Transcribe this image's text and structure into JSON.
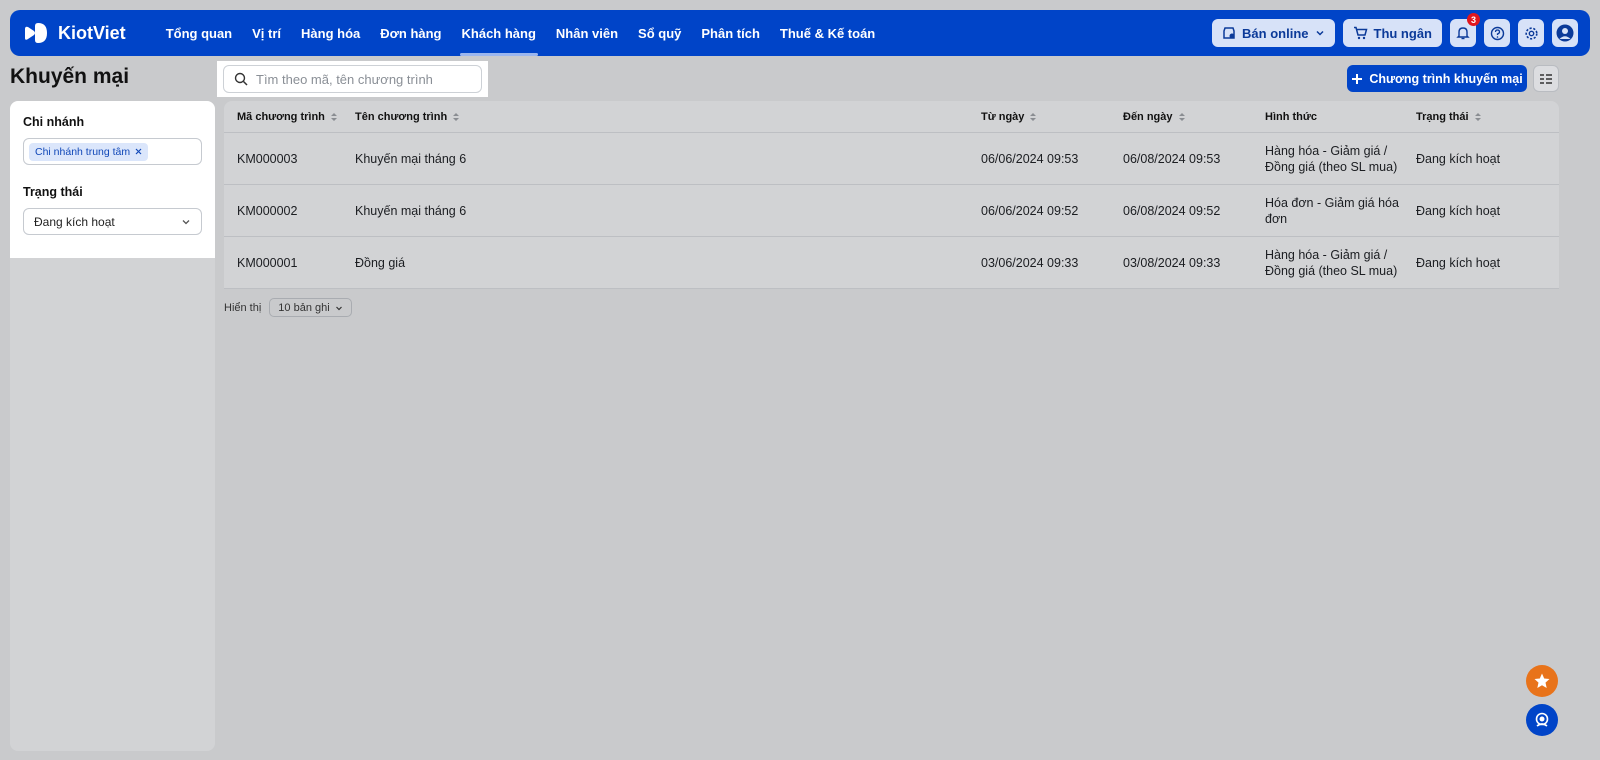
{
  "brand": {
    "name": "KiotViet"
  },
  "nav": {
    "items": [
      {
        "label": "Tổng quan"
      },
      {
        "label": "Vị trí"
      },
      {
        "label": "Hàng hóa"
      },
      {
        "label": "Đơn hàng"
      },
      {
        "label": "Khách hàng",
        "active": true
      },
      {
        "label": "Nhân viên"
      },
      {
        "label": "Sổ quỹ"
      },
      {
        "label": "Phân tích"
      },
      {
        "label": "Thuế & Kế toán"
      }
    ],
    "online_label": "Bán online",
    "cashier_label": "Thu ngân",
    "notification_count": "3"
  },
  "page": {
    "title": "Khuyến mại",
    "search_placeholder": "Tìm theo mã, tên chương trình",
    "add_button_label": "Chương trình khuyến mại"
  },
  "filters": {
    "branch_label": "Chi nhánh",
    "branch_tag": "Chi nhánh trung tâm",
    "status_label": "Trạng thái",
    "status_value": "Đang kích hoạt"
  },
  "table": {
    "columns": [
      "Mã chương trình",
      "Tên chương trình",
      "Từ ngày",
      "Đến ngày",
      "Hình thức",
      "Trạng thái"
    ],
    "rows": [
      {
        "code": "KM000003",
        "name": "Khuyến mại tháng 6",
        "from": "06/06/2024 09:53",
        "to": "06/08/2024 09:53",
        "type": "Hàng hóa - Giảm giá / Đồng giá (theo SL mua)",
        "status": "Đang kích hoạt"
      },
      {
        "code": "KM000002",
        "name": "Khuyến mại tháng 6",
        "from": "06/06/2024 09:52",
        "to": "06/08/2024 09:52",
        "type": "Hóa đơn - Giảm giá hóa đơn",
        "status": "Đang kích hoạt"
      },
      {
        "code": "KM000001",
        "name": "Đồng giá",
        "from": "03/06/2024 09:33",
        "to": "03/08/2024 09:33",
        "type": "Hàng hóa - Giảm giá / Đồng giá (theo SL mua)",
        "status": "Đang kích hoạt"
      }
    ]
  },
  "pager": {
    "label": "Hiển thị",
    "value": "10 bản ghi"
  },
  "colors": {
    "brand": "#0044c8",
    "badge": "#e0171f",
    "fab_star": "#e8731a",
    "fab_support": "#0044c8"
  },
  "icons": [
    "search-icon",
    "bell-icon",
    "help-icon",
    "gear-icon",
    "user-icon",
    "cart-icon",
    "shop-icon",
    "plus-icon",
    "columns-icon",
    "star-icon",
    "support-icon"
  ]
}
